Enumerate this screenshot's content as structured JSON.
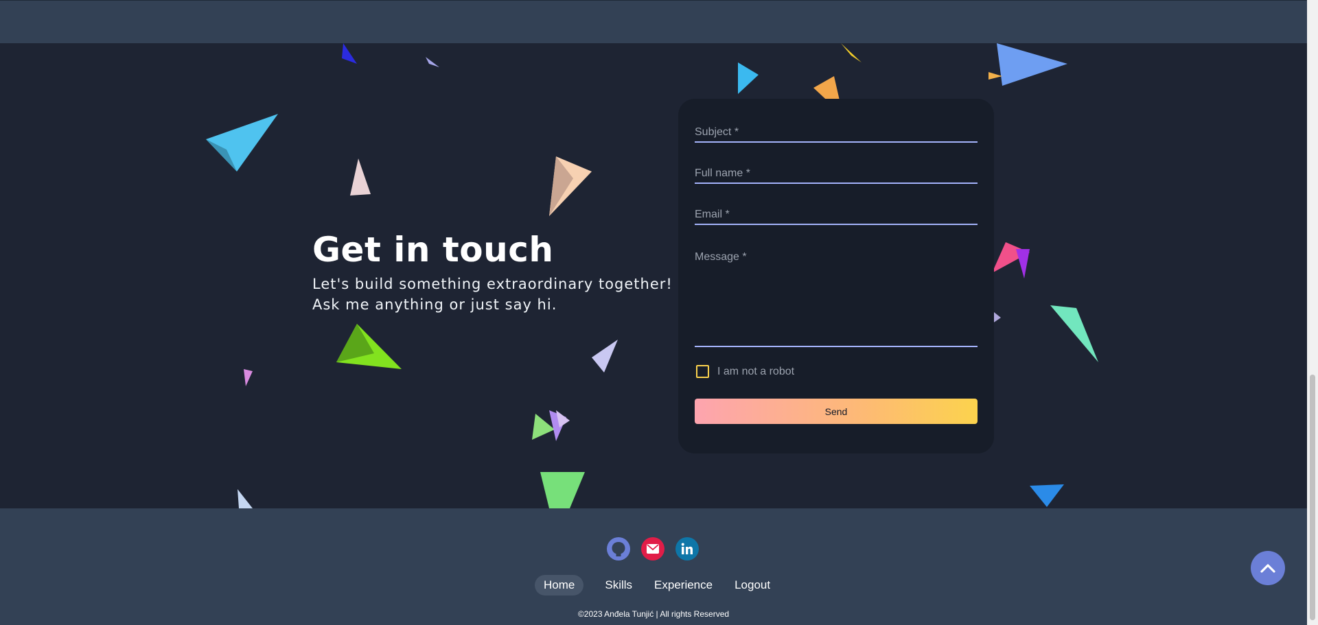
{
  "contact": {
    "title": "Get in touch",
    "subtitle_line1": "Let's build something extraordinary together!",
    "subtitle_line2": "Ask me anything or just say hi."
  },
  "form": {
    "subject_label": "Subject *",
    "fullname_label": "Full name *",
    "email_label": "Email *",
    "message_label": "Message *",
    "robot_label": "I am not a robot",
    "send_label": "Send"
  },
  "footer": {
    "socials": [
      {
        "icon": "github-icon",
        "color": "#6b7fd7"
      },
      {
        "icon": "mail-icon",
        "color": "#e11d48"
      },
      {
        "icon": "linkedin-icon",
        "color": "#0e76a8"
      }
    ],
    "nav": [
      "Home",
      "Skills",
      "Experience",
      "Logout"
    ],
    "active_nav": "Home",
    "copyright": "©2023 Anđela Tunjić | All rights Reserved"
  },
  "colors": {
    "accent": "#a5b4fc",
    "background": "#1e2433",
    "footer_bg": "#334155"
  }
}
